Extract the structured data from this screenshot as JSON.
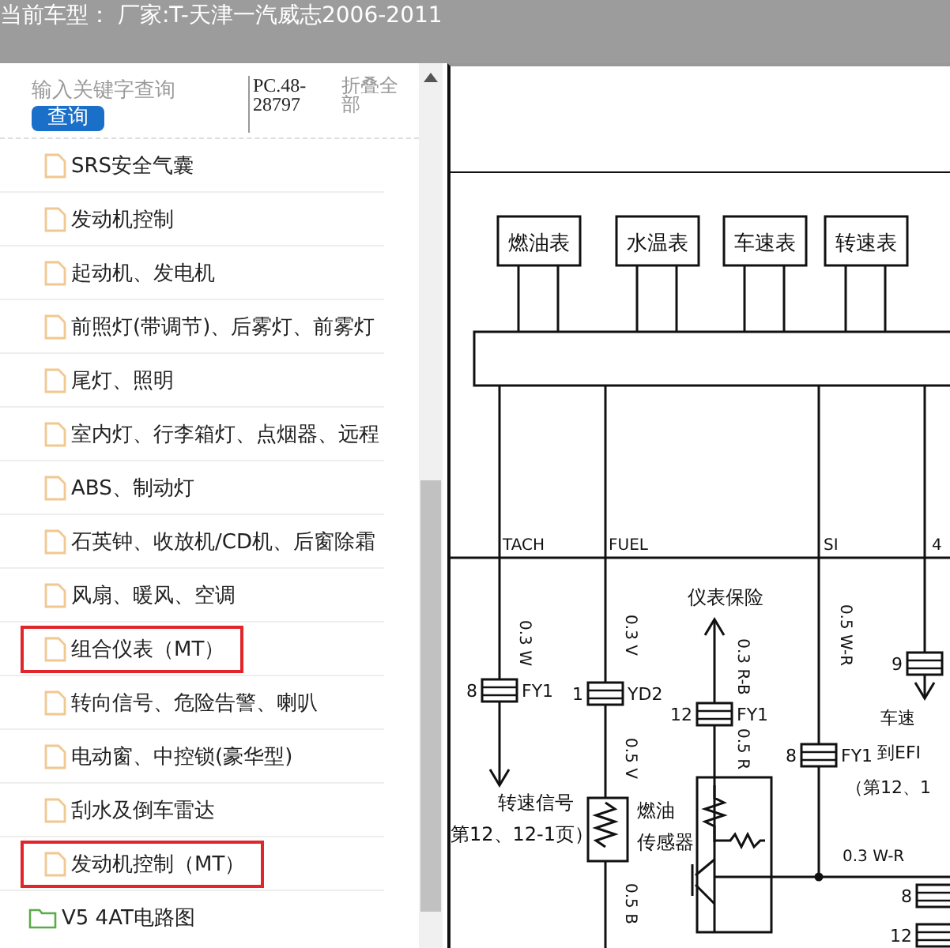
{
  "header": {
    "title": "当前车型： 厂家:T-天津一汽威志2006-2011"
  },
  "search": {
    "placeholder": "输入关键字查询",
    "button": "查询",
    "code": "PC.48-28797",
    "collapse": "折叠全部"
  },
  "tree": [
    {
      "kind": "file",
      "label": "SRS安全气囊",
      "highlighted": false
    },
    {
      "kind": "file",
      "label": "发动机控制",
      "highlighted": false
    },
    {
      "kind": "file",
      "label": "起动机、发电机",
      "highlighted": false
    },
    {
      "kind": "file",
      "label": "前照灯(带调节)、后雾灯、前雾灯",
      "highlighted": false
    },
    {
      "kind": "file",
      "label": "尾灯、照明",
      "highlighted": false
    },
    {
      "kind": "file",
      "label": "室内灯、行李箱灯、点烟器、远程",
      "highlighted": false
    },
    {
      "kind": "file",
      "label": "ABS、制动灯",
      "highlighted": false
    },
    {
      "kind": "file",
      "label": "石英钟、收放机/CD机、后窗除霜",
      "highlighted": false
    },
    {
      "kind": "file",
      "label": "风扇、暖风、空调",
      "highlighted": false
    },
    {
      "kind": "file",
      "label": "组合仪表（MT）",
      "highlighted": true
    },
    {
      "kind": "file",
      "label": "转向信号、危险告警、喇叭",
      "highlighted": false
    },
    {
      "kind": "file",
      "label": "电动窗、中控锁(豪华型)",
      "highlighted": false
    },
    {
      "kind": "file",
      "label": "刮水及倒车雷达",
      "highlighted": false
    },
    {
      "kind": "file",
      "label": "发动机控制（MT）",
      "highlighted": true
    },
    {
      "kind": "folder",
      "label": "V5 4AT电路图",
      "highlighted": false
    }
  ],
  "diagram": {
    "gauges": [
      "燃油表",
      "水温表",
      "车速表",
      "转速表"
    ],
    "signals": [
      "TACH",
      "FUEL",
      "SI",
      "4"
    ],
    "wires": [
      "0.3 W",
      "0.3 V",
      "0.3 R-B",
      "0.5 W-R",
      "0.5 V",
      "0.5 R",
      "0.5 B",
      "0.3 W-R"
    ],
    "connectors": [
      {
        "pin": "8",
        "name": "FY1"
      },
      {
        "pin": "1",
        "name": "YD2"
      },
      {
        "pin": "12",
        "name": "FY1"
      },
      {
        "pin": "8",
        "name": "FY1"
      },
      {
        "pin": "9"
      },
      {
        "pin": "8"
      },
      {
        "pin": "12"
      }
    ],
    "notes": [
      "仪表保险",
      "转速信号",
      "第12、12-1页）",
      "燃油",
      "传感器",
      "车速",
      "到EFI",
      "（第12、1"
    ]
  }
}
